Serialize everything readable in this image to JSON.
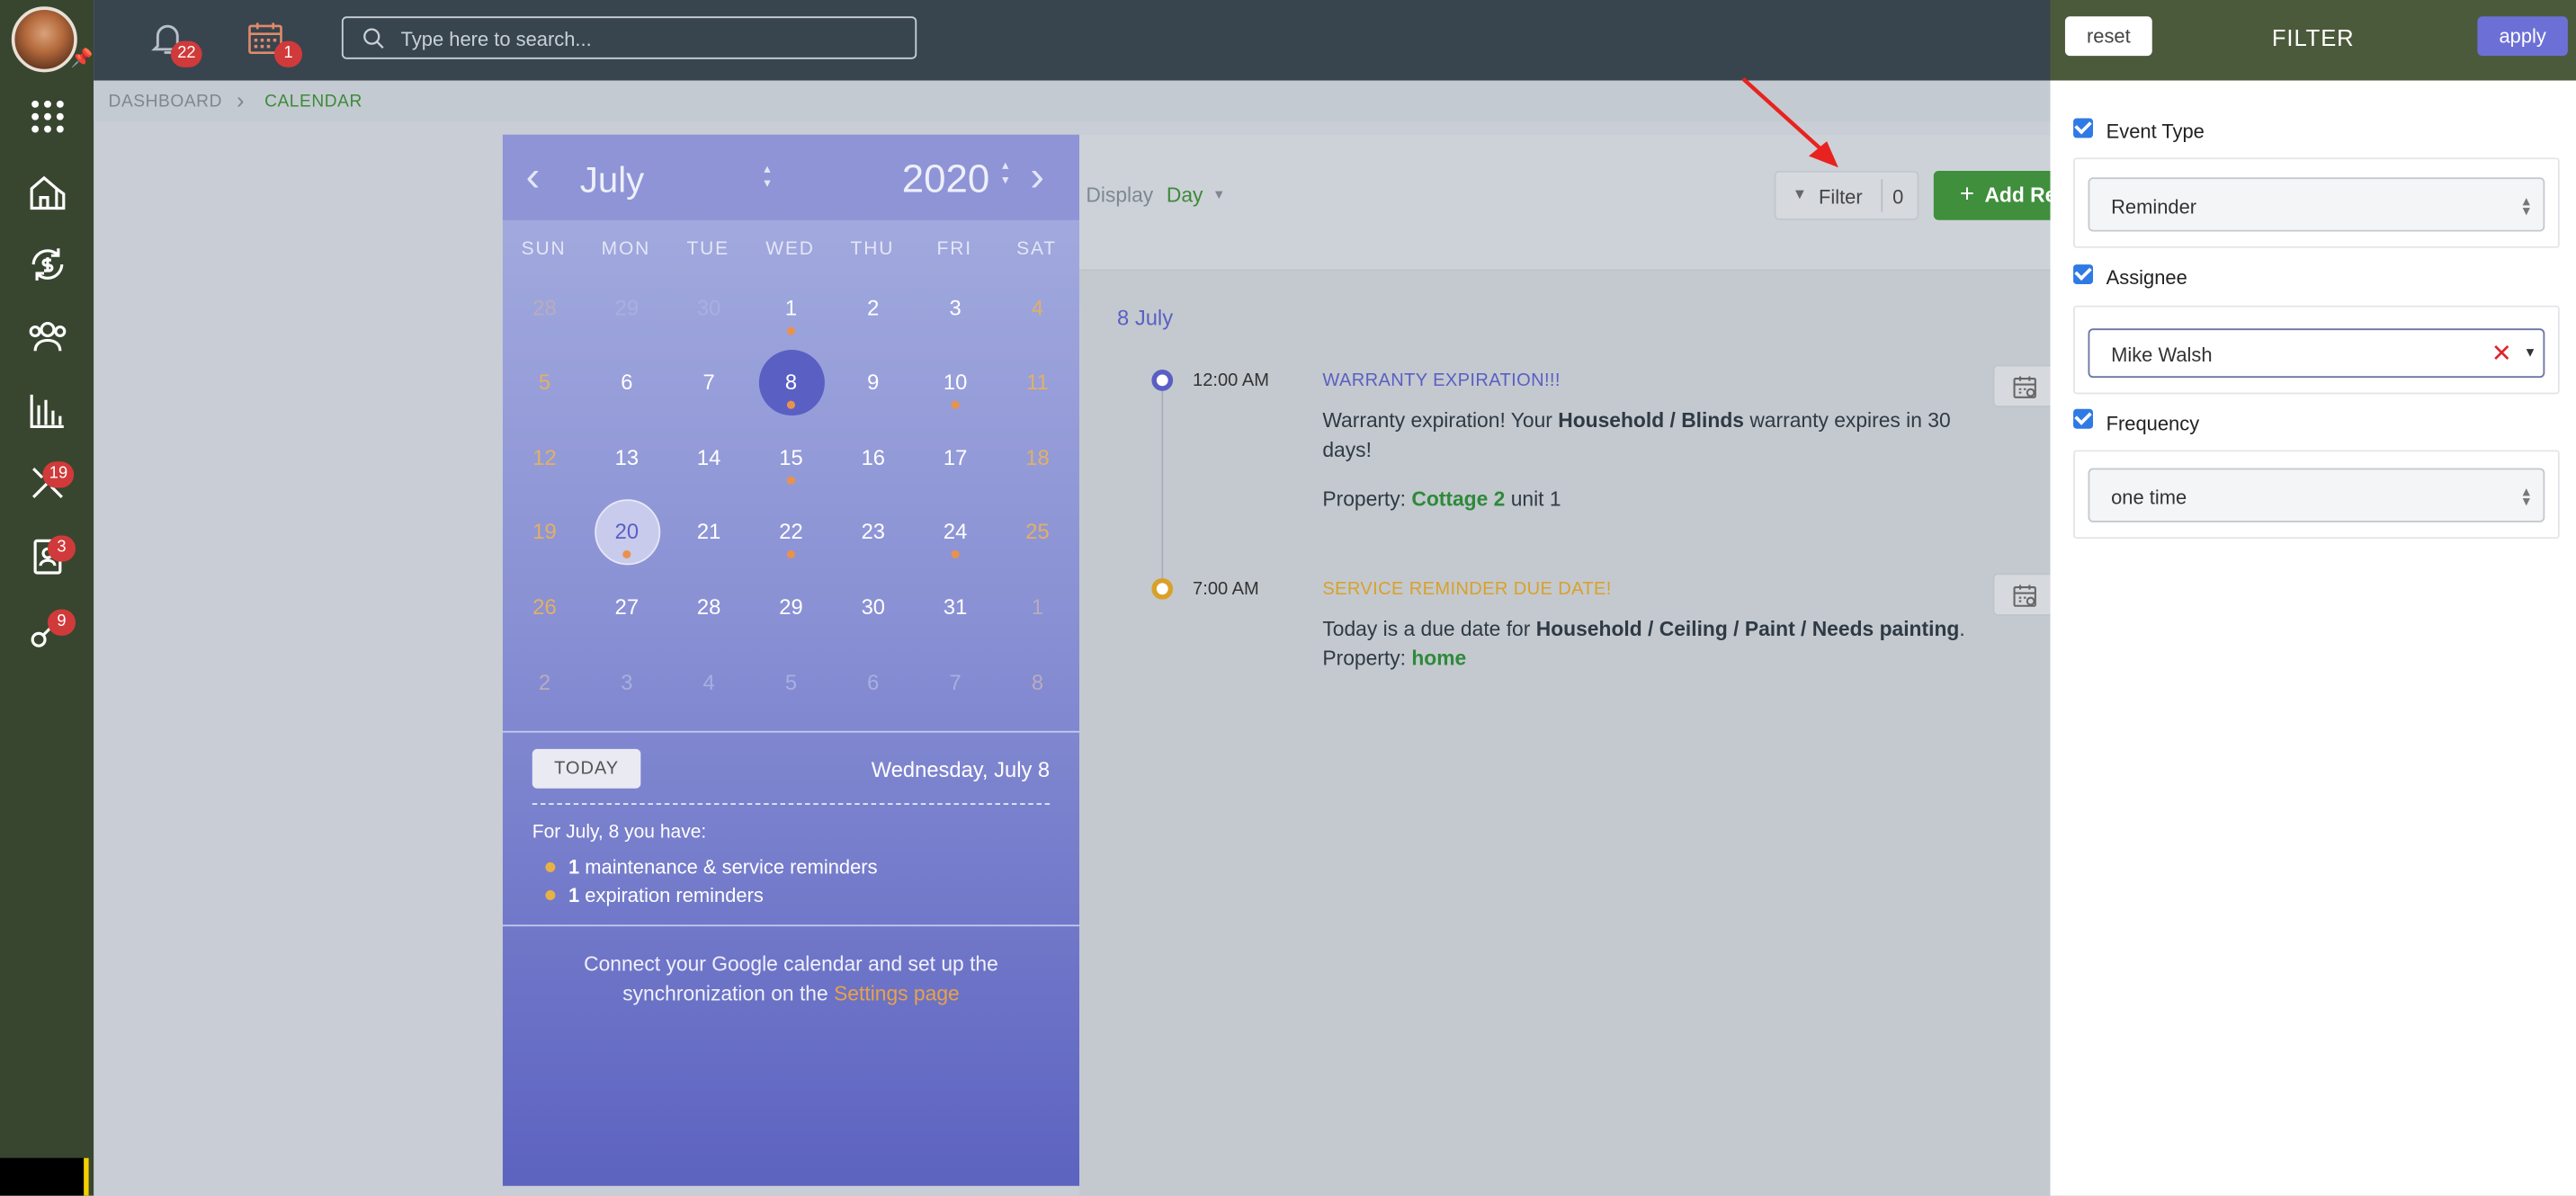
{
  "topbar": {
    "notifications_count": "22",
    "calendar_count": "1",
    "search_placeholder": "Type here to search..."
  },
  "sidebar": {
    "badges": {
      "tools": "19",
      "contacts": "3",
      "keys": "9"
    }
  },
  "breadcrumb": {
    "dashboard": "DASHBOARD",
    "separator": "›",
    "calendar": "CALENDAR"
  },
  "calendar": {
    "month": "July",
    "year": "2020",
    "weekdays": [
      "SUN",
      "MON",
      "TUE",
      "WED",
      "THU",
      "FRI",
      "SAT"
    ],
    "weeks": [
      [
        {
          "d": "28",
          "m": 1
        },
        {
          "d": "29",
          "m": 1
        },
        {
          "d": "30",
          "m": 1
        },
        {
          "d": "1",
          "dot": 1
        },
        {
          "d": "2"
        },
        {
          "d": "3"
        },
        {
          "d": "4"
        }
      ],
      [
        {
          "d": "5"
        },
        {
          "d": "6"
        },
        {
          "d": "7"
        },
        {
          "d": "8",
          "sel": 1,
          "dot": 1
        },
        {
          "d": "9"
        },
        {
          "d": "10",
          "dot": 1
        },
        {
          "d": "11"
        }
      ],
      [
        {
          "d": "12"
        },
        {
          "d": "13"
        },
        {
          "d": "14"
        },
        {
          "d": "15",
          "dot": 1
        },
        {
          "d": "16"
        },
        {
          "d": "17"
        },
        {
          "d": "18"
        }
      ],
      [
        {
          "d": "19"
        },
        {
          "d": "20",
          "today": 1,
          "dot": 1
        },
        {
          "d": "21"
        },
        {
          "d": "22",
          "dot": 1
        },
        {
          "d": "23"
        },
        {
          "d": "24",
          "dot": 1
        },
        {
          "d": "25"
        }
      ],
      [
        {
          "d": "26"
        },
        {
          "d": "27"
        },
        {
          "d": "28"
        },
        {
          "d": "29"
        },
        {
          "d": "30"
        },
        {
          "d": "31"
        },
        {
          "d": "1",
          "m": 1
        }
      ],
      [
        {
          "d": "2",
          "m": 1
        },
        {
          "d": "3",
          "m": 1
        },
        {
          "d": "4",
          "m": 1
        },
        {
          "d": "5",
          "m": 1
        },
        {
          "d": "6",
          "m": 1
        },
        {
          "d": "7",
          "m": 1
        },
        {
          "d": "8",
          "m": 1
        }
      ]
    ],
    "today_label": "TODAY",
    "selected_date": "Wednesday, July 8",
    "summary_title": "For July, 8 you have:",
    "summary": [
      {
        "count": "1",
        "text": "maintenance & service reminders"
      },
      {
        "count": "1",
        "text": "expiration reminders"
      }
    ],
    "connect_text": "Connect your Google calendar and set up the",
    "connect_text2": "synchronization on the",
    "settings_link": "Settings page"
  },
  "main": {
    "display_label": "Display",
    "display_value": "Day",
    "filter_label": "Filter",
    "filter_count": "0",
    "add_label": "Add Re",
    "date_heading": "8 July",
    "events": [
      {
        "time": "12:00 AM",
        "title": "WARRANTY EXPIRATION!!!",
        "color": "#5a5fc4",
        "l1a": "Warranty expiration! Your ",
        "l1b": "Household / Blinds",
        "l1c": " warranty expires in 30",
        "l2": "days!",
        "prop_label": "Property: ",
        "prop_value": "Cottage 2",
        "prop_rest": " unit 1"
      },
      {
        "time": "7:00 AM",
        "title": "SERVICE REMINDER DUE DATE!",
        "color": "#d9a12a",
        "l1a": "Today is a due date for ",
        "l1b": "Household / Ceiling / Paint / Needs painting",
        "l1c": ".",
        "prop_label": "Property: ",
        "prop_value": "home"
      }
    ]
  },
  "filter": {
    "reset": "reset",
    "title": "FILTER",
    "apply": "apply",
    "event_type_label": "Event Type",
    "event_type_value": "Reminder",
    "assignee_label": "Assignee",
    "assignee_value": "Mike Walsh",
    "frequency_label": "Frequency",
    "frequency_value": "one time"
  }
}
